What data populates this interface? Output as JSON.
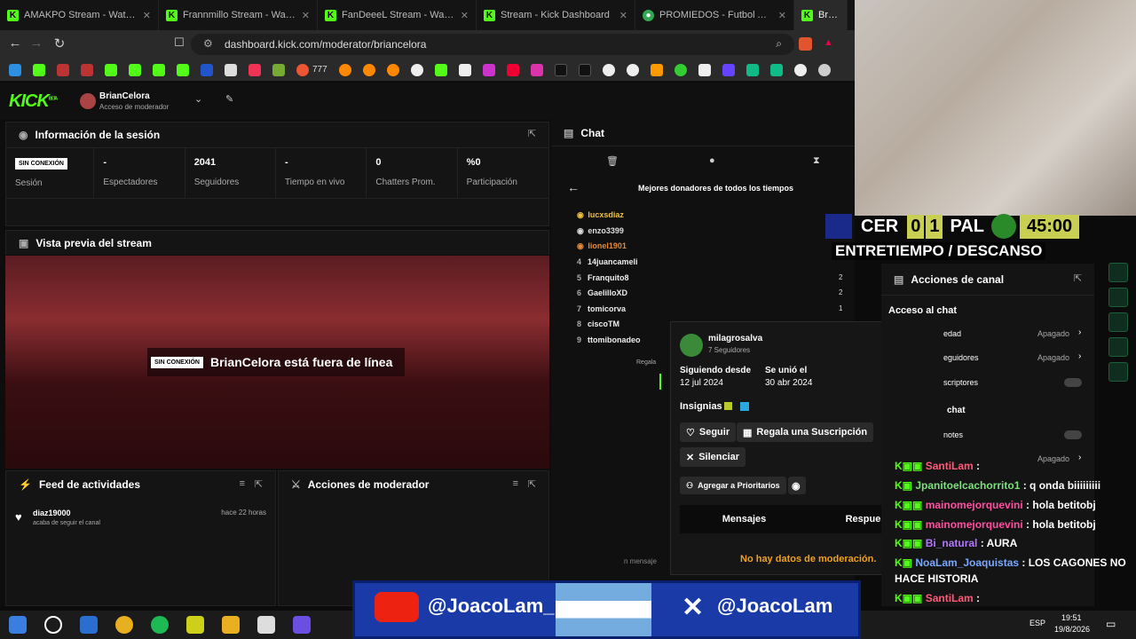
{
  "tabs": [
    {
      "label": "AMAKPO Stream - Watch L",
      "icon": "kick"
    },
    {
      "label": "Frannmillo Stream - Watch",
      "icon": "kick"
    },
    {
      "label": "FanDeeeL Stream - Watch L",
      "icon": "kick"
    },
    {
      "label": "Stream - Kick Dashboard",
      "icon": "kick"
    },
    {
      "label": "PROMIEDOS - Futbol Argentin",
      "icon": "globe"
    },
    {
      "label": "BrianCe",
      "icon": "kick"
    }
  ],
  "address_bar": {
    "url": "dashboard.kick.com/moderator/briancelora"
  },
  "bookmarks": {
    "counter_label": "777"
  },
  "header": {
    "logo": "KICK",
    "logo_sup": "BETA",
    "username": "BrianCelora",
    "role": "Acceso de moderador"
  },
  "session": {
    "title": "Información de la sesión",
    "status_badge": "SIN CONEXIÓN",
    "status_label": "Sesión",
    "stats": [
      {
        "value": "-",
        "label": "Espectadores"
      },
      {
        "value": "2041",
        "label": "Seguidores"
      },
      {
        "value": "-",
        "label": "Tiempo en vivo"
      },
      {
        "value": "0",
        "label": "Chatters Prom."
      },
      {
        "value": "%0",
        "label": "Participación"
      }
    ]
  },
  "preview": {
    "title": "Vista previa del stream",
    "badge": "SIN CONEXIÓN",
    "offline_text": "BrianCelora está fuera de línea"
  },
  "feed": {
    "title": "Feed de actividades",
    "item_user": "diaz19000",
    "item_text": "acaba de seguir el canal",
    "item_time": "hace 22 horas"
  },
  "mod_actions": {
    "title": "Acciones de moderador"
  },
  "chat": {
    "title": "Chat",
    "leaderboard_title": "Mejores donadores de todos los tiempos",
    "donors": [
      {
        "rank": "",
        "name": "lucxsdiaz",
        "color": "#f0c040"
      },
      {
        "rank": "",
        "name": "enzo3399",
        "color": "#dddddd"
      },
      {
        "rank": "",
        "name": "lionel1901",
        "color": "#e08a3c"
      },
      {
        "rank": "4",
        "name": "14juancameli",
        "color": "#eeeeee"
      },
      {
        "rank": "5",
        "name": "Franquito8",
        "color": "#eeeeee"
      },
      {
        "rank": "6",
        "name": "GaelilloXD",
        "color": "#eeeeee"
      },
      {
        "rank": "7",
        "name": "tomicorva",
        "color": "#eeeeee"
      },
      {
        "rank": "8",
        "name": "ciscoTM",
        "color": "#eeeeee"
      },
      {
        "rank": "9",
        "name": "ttomibonadeo",
        "color": "#eeeeee"
      }
    ],
    "donor_counts": [
      "2",
      "2",
      "1"
    ],
    "regala_label": "Regala",
    "message_placeholder": "n mensaje"
  },
  "user_card": {
    "username": "milagrosalva",
    "followers": "7 Seguidores",
    "following_label": "Siguiendo desde",
    "following_date": "12 jul 2024",
    "joined_label": "Se unió el",
    "joined_date": "30 abr 2024",
    "badges_label": "Insignias",
    "follow": "Seguir",
    "gift": "Regala una Suscripción",
    "mute": "Silenciar",
    "add_priority": "Agregar a Prioritarios",
    "tab_messages": "Mensajes",
    "tab_replies": "Respuestas",
    "no_data": "No hay datos de moderación."
  },
  "scoreboard": {
    "home": "CER",
    "home_score": "0",
    "away_score": "1",
    "away": "PAL",
    "clock": "45:00",
    "status": "ENTRETIEMPO / DESCANSO"
  },
  "channel_actions": {
    "title": "Acciones de canal",
    "section": "Acceso al chat",
    "items": [
      {
        "label": "edad",
        "value": "Apagado"
      },
      {
        "label": "eguidores",
        "value": "Apagado"
      },
      {
        "label": "scriptores",
        "value": ""
      }
    ],
    "chat_label": "chat",
    "notes_label": "notes",
    "apagado": "Apagado"
  },
  "overlay_chat": [
    {
      "user": "SantiLam",
      "text": " : ",
      "color": "#ff5a7a"
    },
    {
      "user": "Jpanitoelcachorrito1",
      "text": " : q onda biiiiiiiii",
      "color": "#7de07d"
    },
    {
      "user": "mainomejorquevini",
      "text": " : hola betitobj",
      "color": "#ff4fa0"
    },
    {
      "user": "mainomejorquevini",
      "text": " : hola betitobj",
      "color": "#ff4fa0"
    },
    {
      "user": "Bi_natural",
      "text": " : AURA",
      "color": "#b277ff"
    },
    {
      "user": "NoaLam_Joaquistas",
      "text": " : LOS CAGONES NO",
      "color": "#7aa8ff"
    },
    {
      "user": "",
      "text": "HACE HISTORIA",
      "color": "#ffffff"
    },
    {
      "user": "SantiLam",
      "text": " : ",
      "color": "#ff5a7a"
    }
  ],
  "banner": {
    "youtube": "@JoacoLam_",
    "x": "@JoacoLam"
  },
  "taskbar": {
    "lang": "ESP",
    "time": "19:51",
    "date": "19/8/2026"
  }
}
